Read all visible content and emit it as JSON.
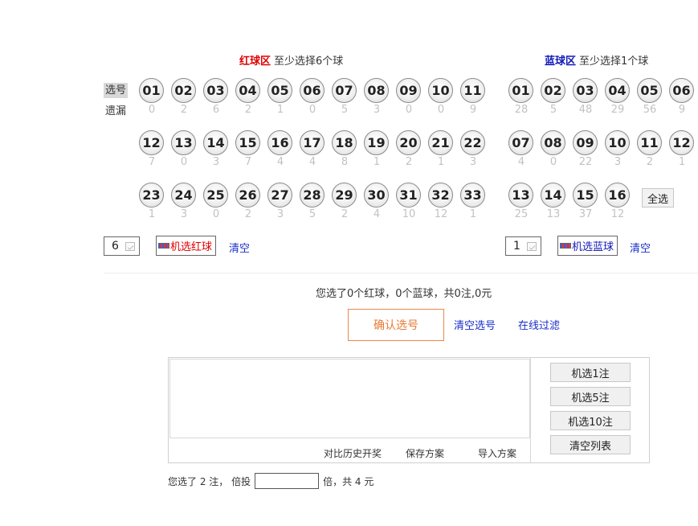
{
  "red_zone": {
    "title": "红球区",
    "hint": "至少选择6个球",
    "balls": [
      {
        "number": "01",
        "miss": "0"
      },
      {
        "number": "02",
        "miss": "2"
      },
      {
        "number": "03",
        "miss": "6"
      },
      {
        "number": "04",
        "miss": "2"
      },
      {
        "number": "05",
        "miss": "1"
      },
      {
        "number": "06",
        "miss": "0"
      },
      {
        "number": "07",
        "miss": "5"
      },
      {
        "number": "08",
        "miss": "3"
      },
      {
        "number": "09",
        "miss": "0"
      },
      {
        "number": "10",
        "miss": "0"
      },
      {
        "number": "11",
        "miss": "9"
      },
      {
        "number": "12",
        "miss": "7"
      },
      {
        "number": "13",
        "miss": "0"
      },
      {
        "number": "14",
        "miss": "3"
      },
      {
        "number": "15",
        "miss": "7"
      },
      {
        "number": "16",
        "miss": "4"
      },
      {
        "number": "17",
        "miss": "4"
      },
      {
        "number": "18",
        "miss": "8"
      },
      {
        "number": "19",
        "miss": "1"
      },
      {
        "number": "20",
        "miss": "2"
      },
      {
        "number": "21",
        "miss": "1"
      },
      {
        "number": "22",
        "miss": "3"
      },
      {
        "number": "23",
        "miss": "1"
      },
      {
        "number": "24",
        "miss": "3"
      },
      {
        "number": "25",
        "miss": "0"
      },
      {
        "number": "26",
        "miss": "2"
      },
      {
        "number": "27",
        "miss": "3"
      },
      {
        "number": "28",
        "miss": "5"
      },
      {
        "number": "29",
        "miss": "2"
      },
      {
        "number": "30",
        "miss": "4"
      },
      {
        "number": "31",
        "miss": "10"
      },
      {
        "number": "32",
        "miss": "12"
      },
      {
        "number": "33",
        "miss": "1"
      }
    ],
    "count_value": "6",
    "random_label": "机选红球",
    "clear_label": "清空"
  },
  "blue_zone": {
    "title": "蓝球区",
    "hint": "至少选择1个球",
    "balls": [
      {
        "number": "01",
        "miss": "28"
      },
      {
        "number": "02",
        "miss": "5"
      },
      {
        "number": "03",
        "miss": "48"
      },
      {
        "number": "04",
        "miss": "29"
      },
      {
        "number": "05",
        "miss": "56"
      },
      {
        "number": "06",
        "miss": "9"
      },
      {
        "number": "07",
        "miss": "4"
      },
      {
        "number": "08",
        "miss": "0"
      },
      {
        "number": "09",
        "miss": "22"
      },
      {
        "number": "10",
        "miss": "3"
      },
      {
        "number": "11",
        "miss": "2"
      },
      {
        "number": "12",
        "miss": "1"
      },
      {
        "number": "13",
        "miss": "25"
      },
      {
        "number": "14",
        "miss": "13"
      },
      {
        "number": "15",
        "miss": "37"
      },
      {
        "number": "16",
        "miss": "12"
      }
    ],
    "select_all_label": "全选",
    "count_value": "1",
    "random_label": "机选蓝球",
    "clear_label": "清空"
  },
  "row_labels": {
    "select": "选号",
    "miss": "遗漏"
  },
  "summary": "您选了0个红球，0个蓝球，共0注,0元",
  "actions": {
    "confirm_label": "确认选号",
    "clear_selection_label": "清空选号",
    "online_filter_label": "在线过滤"
  },
  "list_panel": {
    "side_buttons": [
      "机选1注",
      "机选5注",
      "机选10注",
      "清空列表"
    ],
    "footer_links": [
      "对比历史开奖",
      "保存方案",
      "导入方案"
    ]
  },
  "bet_line": {
    "prefix": "您选了 2 注， 倍投",
    "multiplier_value": "",
    "suffix": "倍，共 4 元"
  },
  "colors": {
    "red_accent": "#e00000",
    "blue_accent": "#1018b8",
    "confirm_accent": "#e87a37",
    "link": "#1a2ec8"
  }
}
